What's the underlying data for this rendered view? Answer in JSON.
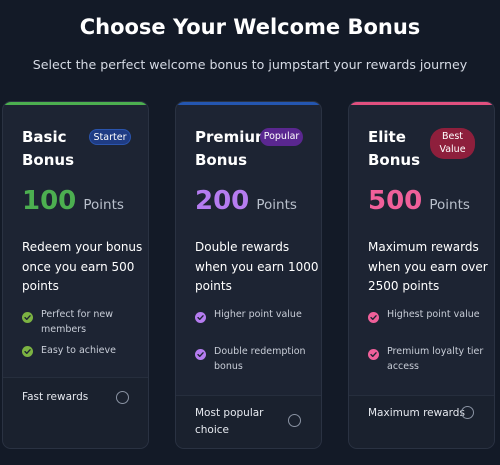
{
  "header": {
    "title": "Choose Your Welcome Bonus",
    "subtitle": "Select the perfect welcome bonus to jumpstart your rewards journey"
  },
  "cards": [
    {
      "title": "Basic Bonus",
      "badge": "Starter",
      "points": "100",
      "points_unit": "Points",
      "description": "Redeem your bonus once you earn 500 points",
      "features": [
        "Perfect for new members",
        "Easy to achieve"
      ],
      "footer_label": "Fast rewards",
      "selected": false,
      "accent": "#4caf50"
    },
    {
      "title": "Premium Bonus",
      "badge": "Popular",
      "points": "200",
      "points_unit": "Points",
      "description": "Double rewards when you earn 1000 points",
      "features": [
        "Higher point value",
        "Double redemption bonus"
      ],
      "footer_label": "Most popular choice",
      "selected": false,
      "accent": "#b57cf0"
    },
    {
      "title": "Elite Bonus",
      "badge": "Best Value",
      "points": "500",
      "points_unit": "Points",
      "description": "Maximum rewards when you earn over 2500 points",
      "features": [
        "Highest point value",
        "Premium loyalty tier access"
      ],
      "footer_label": "Maximum rewards",
      "selected": false,
      "accent": "#f0609a"
    }
  ],
  "colors": {
    "background": "#131a27",
    "card_background": "#1d2433",
    "basic_topbar": "#4caf50",
    "premium_topbar": "#2456b0",
    "elite_topbar": "#e0507f"
  },
  "icons": {
    "feature_check": "check-circle-icon",
    "option_radio": "radio-button-icon"
  }
}
